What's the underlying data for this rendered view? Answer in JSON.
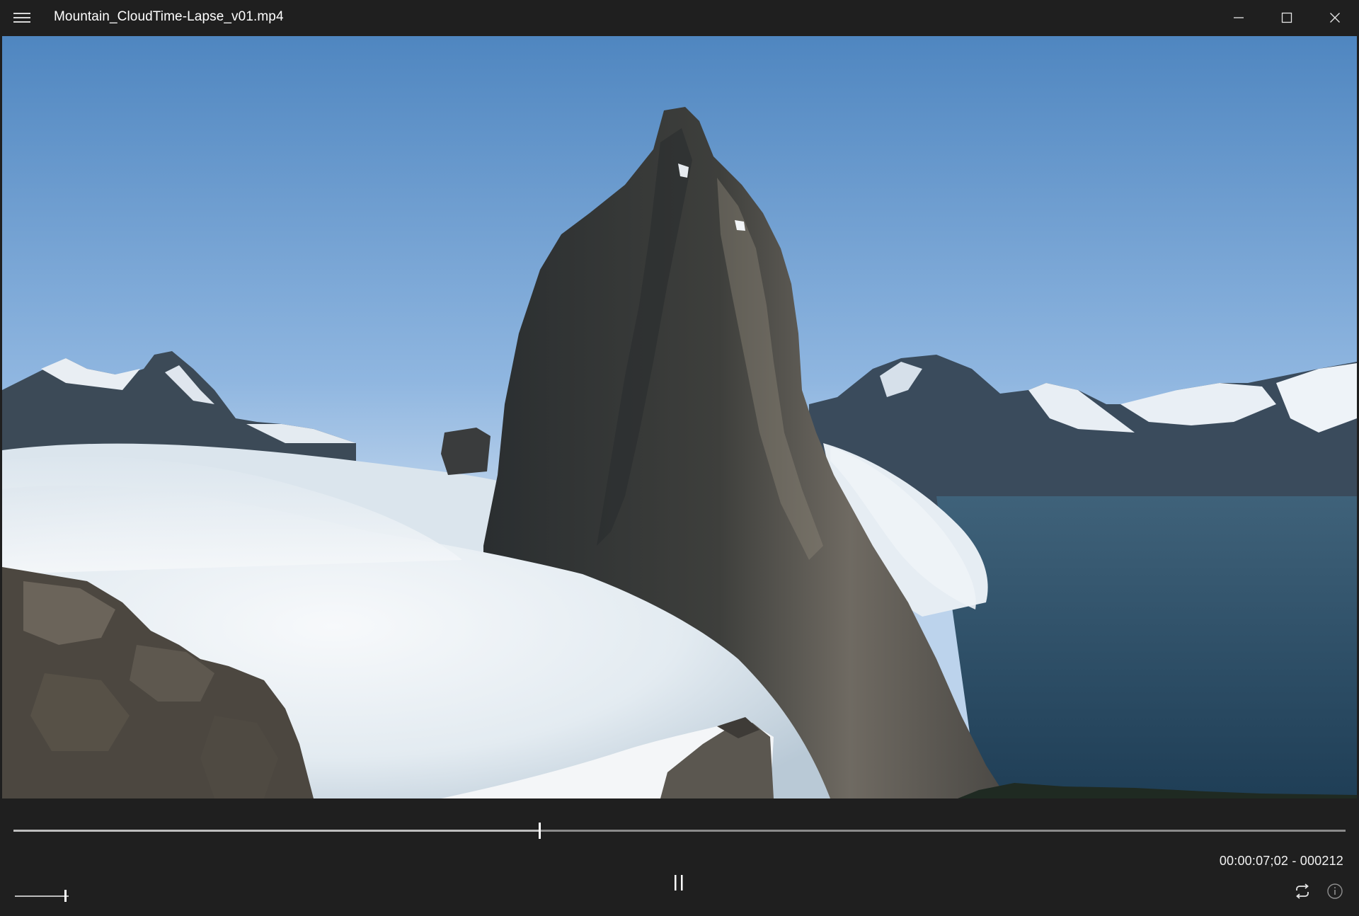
{
  "window": {
    "title": "Mountain_CloudTime-Lapse_v01.mp4",
    "controls": {
      "minimize_icon": "minimize-icon",
      "maximize_icon": "maximize-icon",
      "close_icon": "close-icon"
    }
  },
  "menu": {
    "icon": "hamburger-menu-icon"
  },
  "video": {
    "content": "mountain-cloud-timelapse-frame"
  },
  "playback": {
    "timecode": "00:00:07;02 - 000212",
    "progress_fraction": 0.395,
    "state_icon": "pause-icon",
    "volume_fraction": 0.95,
    "loop_icon": "loop-icon",
    "info_icon": "info-icon"
  },
  "colors": {
    "chrome_background": "#1f1f1f",
    "text": "#ffffff",
    "seek_track": "#8a8a8a"
  }
}
